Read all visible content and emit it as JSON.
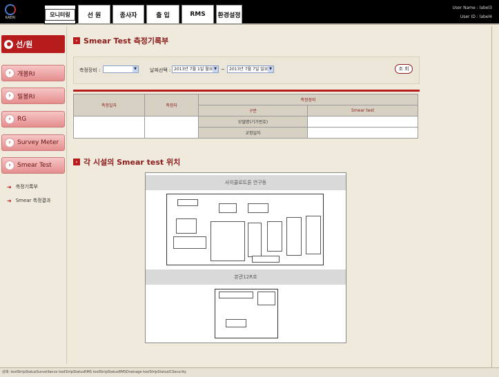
{
  "header": {
    "logo_text": "KAERI",
    "tabs": [
      "모니터링",
      "선 원",
      "종사자",
      "출 입",
      "RMS",
      "환경설정"
    ],
    "user_name_label": "User Name :",
    "user_name": "label3",
    "user_id_label": "User ID :",
    "user_id": "label4"
  },
  "sidebar": {
    "title": "선/원",
    "items": [
      "개봉RI",
      "밀봉RI",
      "RG",
      "Survey Meter",
      "Smear Test"
    ],
    "sub_items": [
      "측정기록부",
      "Smear 측정결과"
    ]
  },
  "main": {
    "title1": "Smear Test 측정기록부",
    "filter": {
      "device_label": "측정장비 :",
      "device_value": "",
      "date_label": "날짜선택 :",
      "date_from": "2013년  7월  1일 월요일",
      "date_sep": "~",
      "date_to": "2013년  7월  7일 일요일",
      "search_button": "조 회"
    },
    "table": {
      "col_date": "측정일자",
      "col_person": "측정자",
      "col_device": "측정장비",
      "sub_col_kind": "구분",
      "sub_col_smear": "Smear test",
      "row1": "모델명(기기번호)",
      "row2": "교정일자"
    },
    "title2": "각 시설의 Smear test 위치",
    "map": {
      "building1": "사이클로트론 연구동",
      "building2": "본관12R호"
    }
  },
  "statusbar": {
    "text": "상태: toolStripStatusSurveillance toolStripStatusRMS toolStripStatusRMSDrainage toolStripStatusICSecurity"
  }
}
